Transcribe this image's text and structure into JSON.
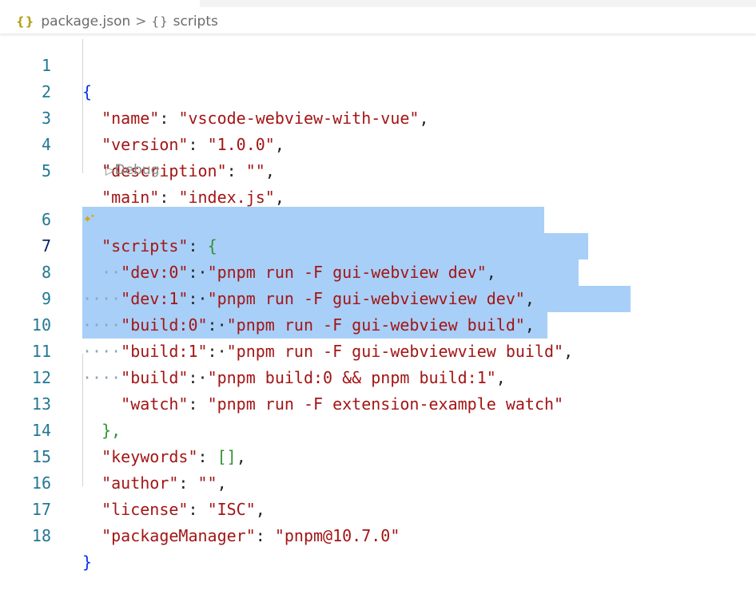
{
  "breadcrumb": {
    "file_icon": "{}",
    "file_name": "package.json",
    "separator": ">",
    "symbol_icon": "{}",
    "symbol_name": "scripts"
  },
  "codelens": {
    "debug_label": "Debug",
    "debug_icon": "play-outline-icon"
  },
  "colors": {
    "string": "#a31515",
    "line_number": "#237893",
    "selection": "#a8cff7",
    "brace_level1": "#0431fa",
    "brace_level2": "#319331"
  },
  "editor": {
    "lines": [
      {
        "n": "1",
        "text": "{"
      },
      {
        "n": "2",
        "key": "\"name\"",
        "val": "\"vscode-webview-with-vue\""
      },
      {
        "n": "3",
        "key": "\"version\"",
        "val": "\"1.0.0\""
      },
      {
        "n": "4",
        "key": "\"description\"",
        "val": "\"\""
      },
      {
        "n": "5",
        "key": "\"main\"",
        "val": "\"index.js\""
      },
      {
        "n": "6",
        "key": "\"scripts\"",
        "val": "{"
      },
      {
        "n": "7",
        "key": "\"dev:0\"",
        "val": "\"pnpm run -F gui-webview dev\""
      },
      {
        "n": "8",
        "key": "\"dev:1\"",
        "val": "\"pnpm run -F gui-webviewview dev\""
      },
      {
        "n": "9",
        "key": "\"build:0\"",
        "val": "\"pnpm run -F gui-webview build\""
      },
      {
        "n": "10",
        "key": "\"build:1\"",
        "val": "\"pnpm run -F gui-webviewview build\""
      },
      {
        "n": "11",
        "key": "\"build\"",
        "val": "\"pnpm build:0 && pnpm build:1\""
      },
      {
        "n": "12",
        "key": "\"watch\"",
        "val": "\"pnpm run -F extension-example watch\""
      },
      {
        "n": "13",
        "text": "},"
      },
      {
        "n": "14",
        "key": "\"keywords\"",
        "val": "[]"
      },
      {
        "n": "15",
        "key": "\"author\"",
        "val": "\"\""
      },
      {
        "n": "16",
        "key": "\"license\"",
        "val": "\"ISC\""
      },
      {
        "n": "17",
        "key": "\"packageManager\"",
        "val": "\"pnpm@10.7.0\""
      },
      {
        "n": "18",
        "text": "}"
      }
    ],
    "active_line": "7",
    "selected_lines": [
      "7",
      "8",
      "9",
      "10",
      "11"
    ],
    "gutter_icon": "sparkle-icon"
  }
}
